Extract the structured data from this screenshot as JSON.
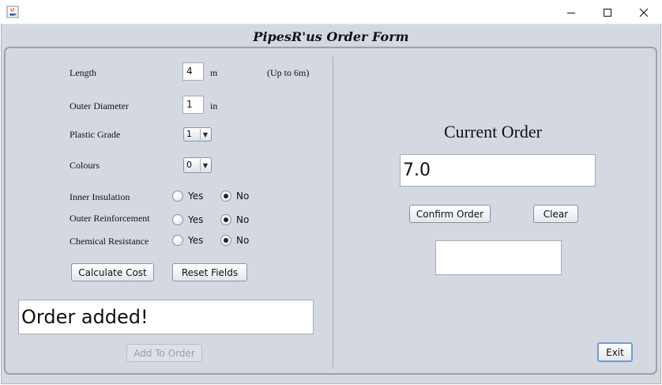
{
  "window": {
    "title_icon": "java-app-icon",
    "minimize_icon": "minimize-icon",
    "maximize_icon": "maximize-icon",
    "close_icon": "close-icon"
  },
  "form_title": "PipesR'us Order Form",
  "left": {
    "length": {
      "label": "Length",
      "value": "4",
      "unit": "m",
      "hint": "(Up to 6m)"
    },
    "outer_diameter": {
      "label": "Outer Diameter",
      "value": "1",
      "unit": "in"
    },
    "plastic_grade": {
      "label": "Plastic Grade",
      "selected": "1"
    },
    "colours": {
      "label": "Colours",
      "selected": "0"
    },
    "inner_insulation": {
      "label": "Inner Insulation",
      "yes": "Yes",
      "no": "No",
      "selected": "No"
    },
    "outer_reinforcement": {
      "label": "Outer Reinforcement",
      "yes": "Yes",
      "no": "No",
      "selected": "No"
    },
    "chemical_resistance": {
      "label": "Chemical Resistance",
      "yes": "Yes",
      "no": "No",
      "selected": "No"
    },
    "calculate_label": "Calculate Cost",
    "reset_label": "Reset Fields",
    "status_text": "Order added!",
    "add_to_order_label": "Add To Order"
  },
  "right": {
    "heading": "Current Order",
    "order_value": "7.0",
    "confirm_label": "Confirm Order",
    "clear_label": "Clear",
    "result_text": "",
    "exit_label": "Exit"
  }
}
